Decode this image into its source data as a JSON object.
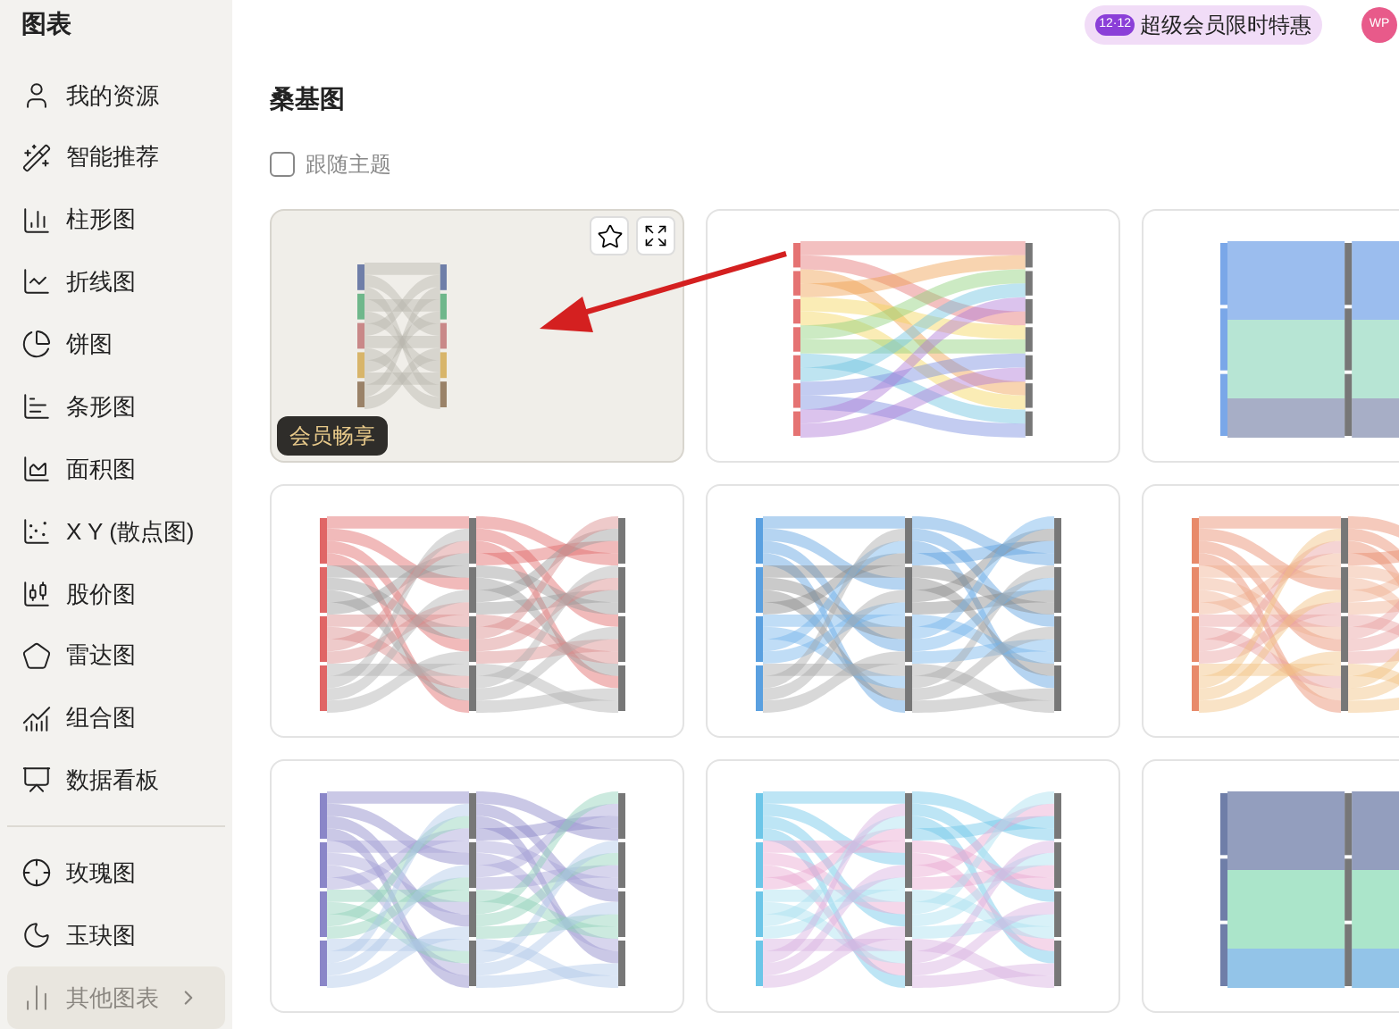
{
  "sidebar": {
    "title": "图表",
    "items": [
      {
        "label": "我的资源",
        "selected": false
      },
      {
        "label": "智能推荐",
        "selected": false
      },
      {
        "label": "柱形图",
        "selected": false
      },
      {
        "label": "折线图",
        "selected": false
      },
      {
        "label": "饼图",
        "selected": false
      },
      {
        "label": "条形图",
        "selected": false
      },
      {
        "label": "面积图",
        "selected": false
      },
      {
        "label": "X Y (散点图)",
        "selected": false
      },
      {
        "label": "股价图",
        "selected": false
      },
      {
        "label": "雷达图",
        "selected": false
      },
      {
        "label": "组合图",
        "selected": false
      },
      {
        "label": "数据看板",
        "selected": false
      }
    ],
    "more_items": [
      {
        "label": "玫瑰图",
        "selected": false
      },
      {
        "label": "玉玦图",
        "selected": false
      },
      {
        "label": "其他图表",
        "selected": true
      }
    ]
  },
  "promo": {
    "badge": "12·12",
    "label": "超级会员限时特惠"
  },
  "avatar": {
    "initials": "WP"
  },
  "section": {
    "title": "桑基图",
    "follow_theme": {
      "label": "跟随主题",
      "checked": false
    }
  },
  "cards": [
    {
      "kind": "mini",
      "hovered": true,
      "badge": "会员畅享"
    },
    {
      "kind": "rainbow",
      "hovered": false
    },
    {
      "kind": "blocks",
      "hovered": false
    },
    {
      "kind": "red",
      "hovered": false
    },
    {
      "kind": "blue",
      "hovered": false
    },
    {
      "kind": "orange",
      "hovered": false
    },
    {
      "kind": "purple",
      "hovered": false
    },
    {
      "kind": "cyan",
      "hovered": false
    },
    {
      "kind": "blocks2",
      "hovered": false
    }
  ]
}
